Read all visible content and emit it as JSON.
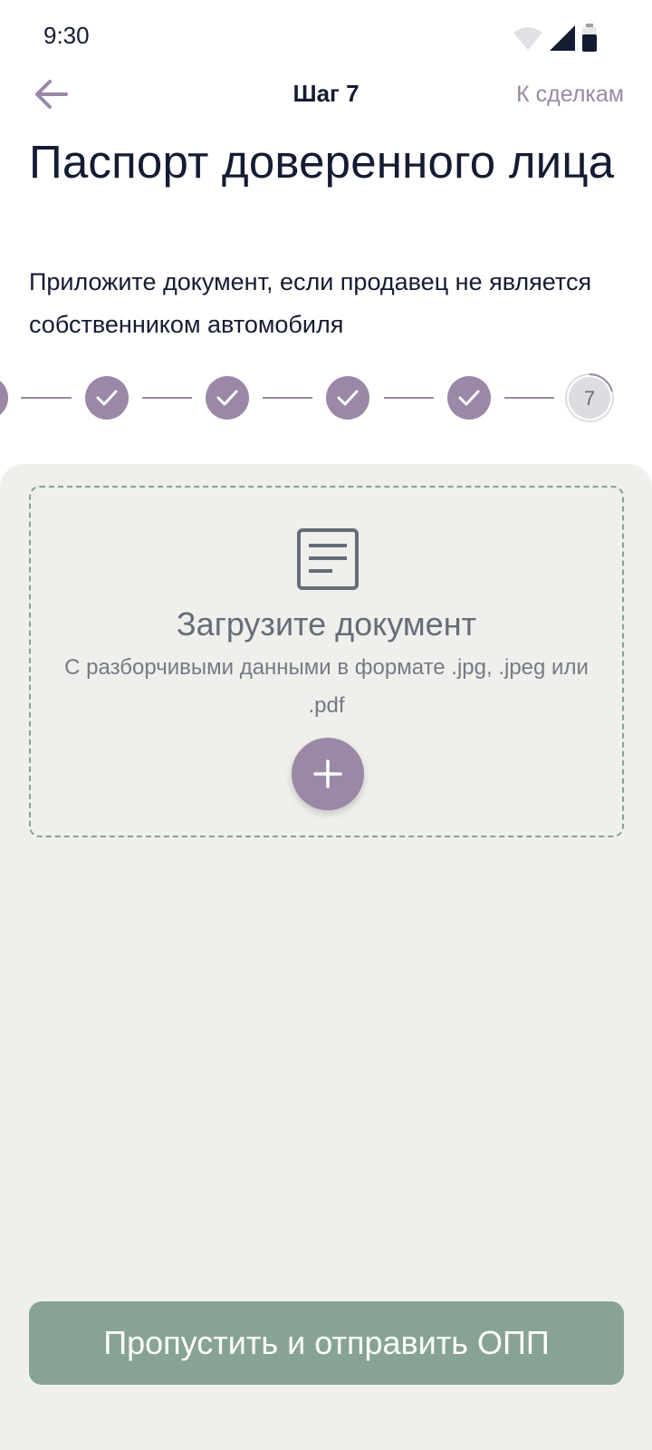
{
  "status_bar": {
    "time": "9:30",
    "icons": [
      "wifi-icon",
      "signal-icon",
      "battery-icon"
    ]
  },
  "header": {
    "back_icon": "arrow-left-icon",
    "title": "Шаг 7",
    "deals_link": "К сделкам"
  },
  "page": {
    "title": "Паспорт доверенного лица",
    "subtitle": "Приложите документ, если продавец не является собственником автомобиля"
  },
  "stepper": {
    "completed_steps": 6,
    "current_step": "7",
    "colors": {
      "done": "#9a88a6",
      "line": "#9a88a6",
      "current_bg": "#dcdde0",
      "current_text": "#6b6f78"
    }
  },
  "upload": {
    "icon": "document-icon",
    "title": "Загрузите документ",
    "description": "С разборчивыми данными в формате .jpg, .jpeg или .pdf",
    "add_icon": "plus-icon"
  },
  "footer": {
    "skip_button": "Пропустить и отправить ОПП"
  },
  "colors": {
    "accent": "#9a88a6",
    "primary_text": "#141c33",
    "panel_bg": "#eff0ec",
    "button_bg": "#87a394",
    "dashed_border": "#83a392"
  }
}
